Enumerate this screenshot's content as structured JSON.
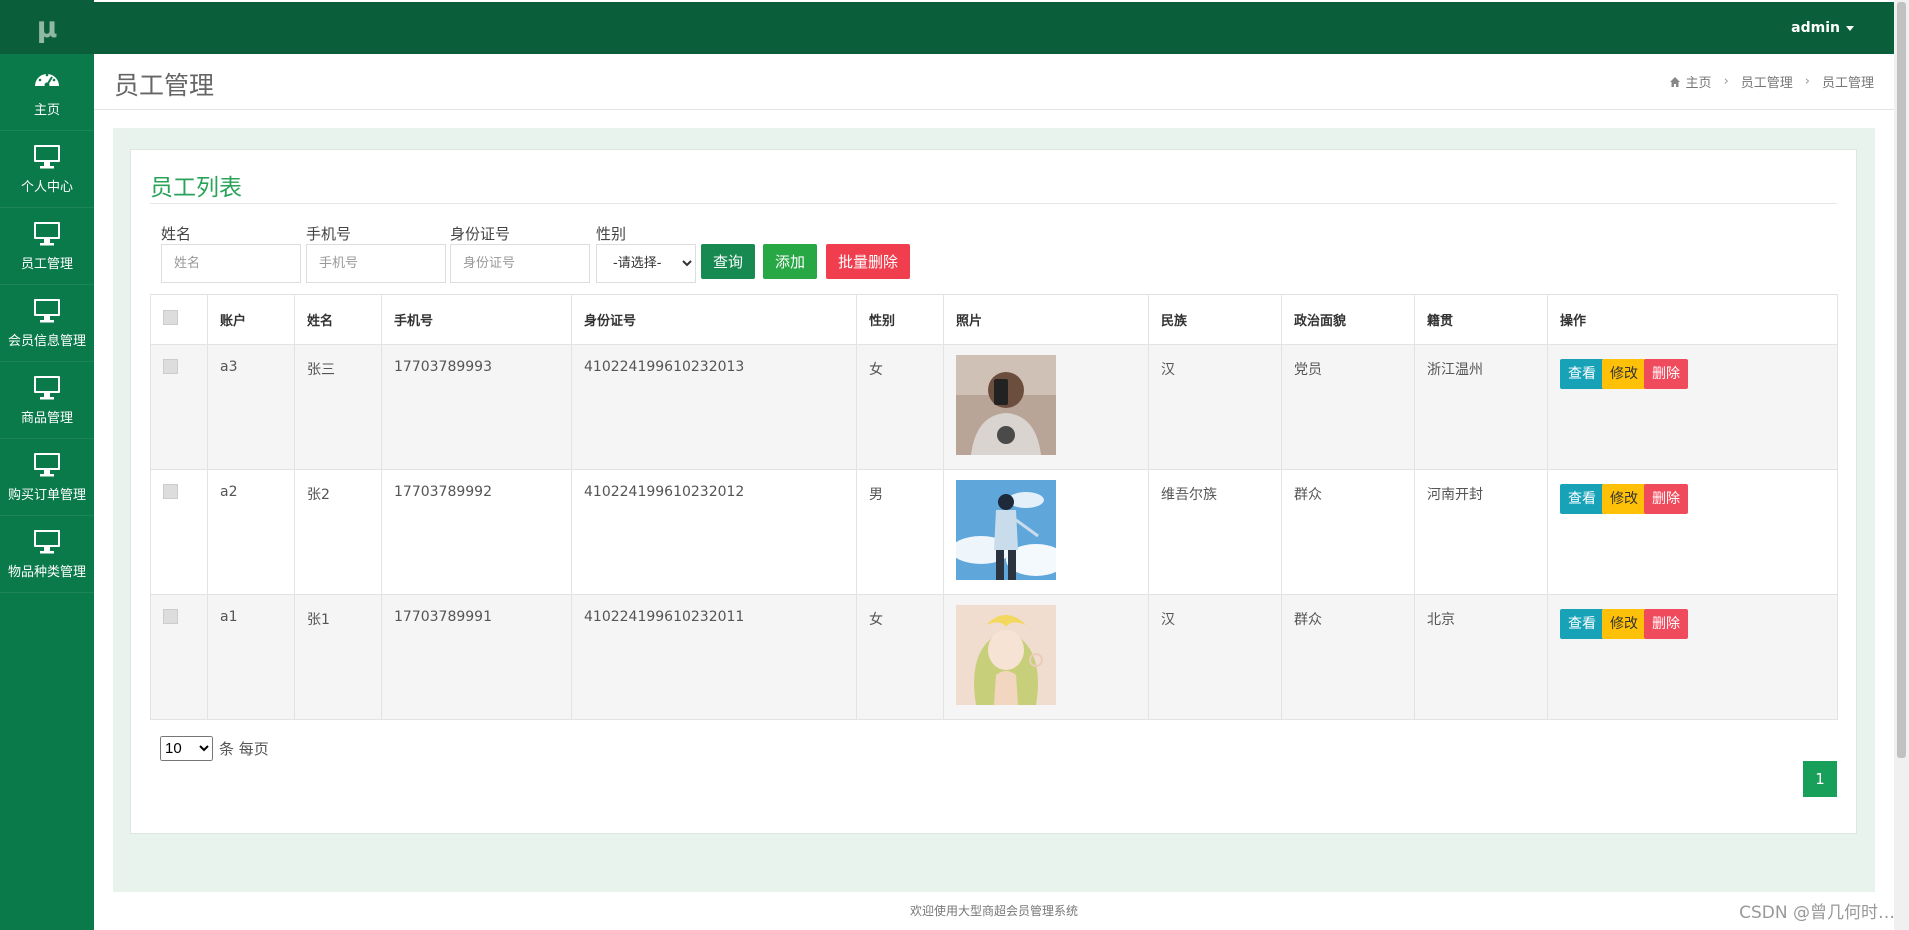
{
  "colors": {
    "sidebar": "#0a7a4a",
    "topbar": "#0b5e3a",
    "accent": "#2aa35a",
    "info": "#17a2b8",
    "warning": "#ffc107",
    "danger": "#f04a5d"
  },
  "logo": "μ",
  "sidebar": {
    "items": [
      {
        "label": "主页",
        "icon": "dashboard-icon"
      },
      {
        "label": "个人中心",
        "icon": "monitor-icon"
      },
      {
        "label": "员工管理",
        "icon": "monitor-icon"
      },
      {
        "label": "会员信息管理",
        "icon": "monitor-icon"
      },
      {
        "label": "商品管理",
        "icon": "monitor-icon"
      },
      {
        "label": "购买订单管理",
        "icon": "monitor-icon"
      },
      {
        "label": "物品种类管理",
        "icon": "monitor-icon"
      }
    ]
  },
  "topbar": {
    "user": "admin"
  },
  "header": {
    "title": "员工管理",
    "breadcrumb": [
      "主页",
      "员工管理",
      "员工管理"
    ]
  },
  "panel": {
    "title": "员工列表"
  },
  "filters": {
    "name": {
      "label": "姓名",
      "placeholder": "姓名"
    },
    "phone": {
      "label": "手机号",
      "placeholder": "手机号"
    },
    "idcard": {
      "label": "身份证号",
      "placeholder": "身份证号"
    },
    "gender": {
      "label": "性别",
      "selected": "-请选择-"
    }
  },
  "buttons": {
    "query": "查询",
    "add": "添加",
    "batch_delete": "批量删除"
  },
  "table": {
    "headers": [
      "账户",
      "姓名",
      "手机号",
      "身份证号",
      "性别",
      "照片",
      "民族",
      "政治面貌",
      "籍贯",
      "操作"
    ],
    "rows": [
      {
        "account": "a3",
        "name": "张三",
        "phone": "17703789993",
        "idcard": "410224199610232013",
        "gender": "女",
        "photo": "portrait-selfie",
        "ethnicity": "汉",
        "politics": "党员",
        "hometown": "浙江温州"
      },
      {
        "account": "a2",
        "name": "张2",
        "phone": "17703789992",
        "idcard": "410224199610232012",
        "gender": "男",
        "photo": "anime-boy-sky",
        "ethnicity": "维吾尔族",
        "politics": "群众",
        "hometown": "河南开封"
      },
      {
        "account": "a1",
        "name": "张1",
        "phone": "17703789991",
        "idcard": "410224199610232011",
        "gender": "女",
        "photo": "anime-girl",
        "ethnicity": "汉",
        "politics": "群众",
        "hometown": "北京"
      }
    ],
    "actions": {
      "view": "查看",
      "edit": "修改",
      "delete": "删除"
    }
  },
  "pagination": {
    "page_size": "10",
    "page_size_suffix": "条 每页",
    "current_page": "1"
  },
  "footer": "欢迎使用大型商超会员管理系统",
  "watermark": "CSDN @曾几何时…"
}
